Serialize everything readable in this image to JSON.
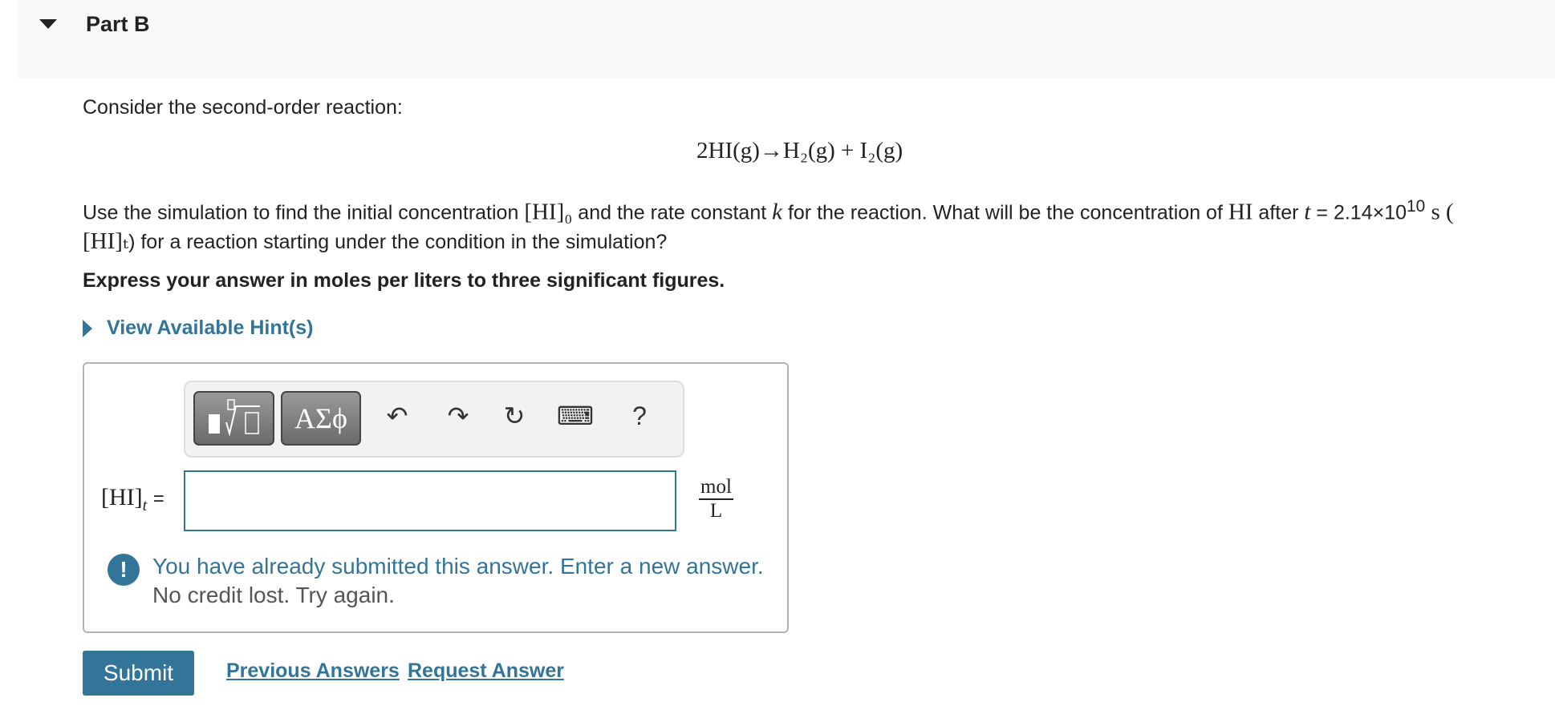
{
  "header": {
    "title": "Part B"
  },
  "question": {
    "intro": "Consider the second-order reaction:",
    "equation": "2HI(g)→H₂(g) + I₂(g)",
    "body_line1_a": "Use the simulation to find the initial concentration ",
    "hi0": "[HI]₀",
    "body_line1_b": " and the rate constant ",
    "k": "k",
    "body_line1_c": " for the reaction. What will be the concentration of ",
    "hi": "HI",
    "body_line1_d": " after ",
    "t": "t",
    "body_line1_e": " = 2.14×10",
    "exp": "10",
    "body_line1_f": " s (",
    "hit": "[HI]ₜ",
    "body_line2": ") for a reaction starting under the condition in the simulation?",
    "instruction": "Express your answer in moles per liters to three significant figures."
  },
  "hint": {
    "label": "View Available Hint(s)"
  },
  "toolbar": {
    "templates_icon": "templates-icon",
    "symbols_label": "ΑΣϕ",
    "undo": "↶",
    "redo": "↷",
    "reset": "↻",
    "keyboard": "⌨",
    "help": "?"
  },
  "answer": {
    "label": "[HI]",
    "label_sub": "t",
    "equals": "=",
    "value": "",
    "units_num": "mol",
    "units_den": "L"
  },
  "feedback": {
    "line1": "You have already submitted this answer. Enter a new answer.",
    "line2": "No credit lost. Try again."
  },
  "actions": {
    "submit": "Submit",
    "previous": "Previous Answers",
    "request": "Request Answer"
  }
}
